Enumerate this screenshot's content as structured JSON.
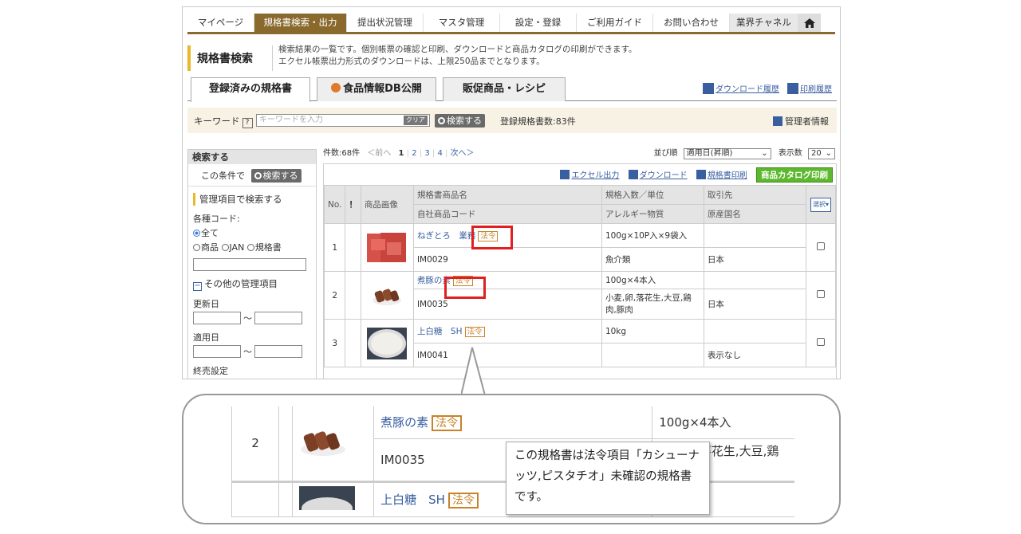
{
  "nav": {
    "items": [
      "マイページ",
      "規格書検索・出力",
      "提出状況管理",
      "マスタ管理",
      "設定・登録",
      "ご利用ガイド",
      "お問い合わせ",
      "業界チャネル"
    ],
    "active_index": 1
  },
  "page": {
    "title": "規格書検索",
    "desc_line1": "検索結果の一覧です。個別帳票の確認と印刷、ダウンロードと商品カタログの印刷ができます。",
    "desc_line2": "エクセル帳票出力形式のダウンロードは、上限250品までとなります。"
  },
  "tabs": [
    "登録済みの規格書",
    "食品情報DB公開",
    "販促商品・レシピ"
  ],
  "history": {
    "download": "ダウンロード履歴",
    "print": "印刷履歴"
  },
  "keyword": {
    "label": "キーワード",
    "help": "?",
    "placeholder": "キーワードを入力",
    "clear": "クリア",
    "search_btn": "検索する",
    "count": "登録規格書数:83件",
    "admin": "管理者情報"
  },
  "sidebar": {
    "header": "検索する",
    "cond_label": "この条件で",
    "search_btn": "検索する",
    "mgmt_title": "管理項目で検索する",
    "code_label": "各種コード:",
    "radio_all": "全て",
    "radio_product": "商品",
    "radio_jan": "JAN",
    "radio_spec": "規格書",
    "other_label": "その他の管理項目",
    "updated_label": "更新日",
    "applied_label": "適用日",
    "tilde": "〜",
    "end_label": "終売設定"
  },
  "results": {
    "count": "件数:68件",
    "prev": "＜前へ",
    "pages": [
      "1",
      "2",
      "3",
      "4"
    ],
    "next": "次へ＞",
    "sort_label": "並び順",
    "sort_value": "適用日(昇順)",
    "per_page_label": "表示数",
    "per_page_value": "20",
    "actions": {
      "excel": "エクセル出力",
      "download": "ダウンロード",
      "print": "規格書印刷",
      "catalog": "商品カタログ印刷"
    },
    "headers": {
      "no": "No.",
      "mark": "！",
      "image": "商品画像",
      "name": "規格書商品名",
      "code": "自社商品コード",
      "qty": "規格入数／単位",
      "allergy": "アレルギー物質",
      "client": "取引先",
      "origin": "原産国名",
      "select": "選択▾"
    },
    "rows": [
      {
        "no": "1",
        "name": "ねぎとろ　業務",
        "badge": "法令",
        "code": "IM0029",
        "qty": "100g×10P入×9袋入",
        "allergy": "魚介類",
        "client": "",
        "origin": "日本"
      },
      {
        "no": "2",
        "name": "煮豚の素",
        "badge": "法令",
        "code": "IM0035",
        "qty": "100g×4本入",
        "allergy": "小麦,卵,落花生,大豆,鶏肉,豚肉",
        "client": "",
        "origin": "日本"
      },
      {
        "no": "3",
        "name": "上白糖　SH",
        "badge": "法令",
        "code": "IM0041",
        "qty": "10kg",
        "allergy": "",
        "client": "",
        "origin": "表示なし"
      }
    ]
  },
  "zoom": {
    "no": "2",
    "name": "煮豚の素",
    "badge": "法令",
    "code": "IM0035",
    "qty": "100g×4本入",
    "allergy_line1": "小麦,卵,落花生,大豆,鶏",
    "allergy_line2": "肉,豚肉",
    "next_name": "上白糖　SH",
    "next_badge": "法令",
    "next_qty": "10kg",
    "tooltip": "この規格書は法令項目「カシューナッツ,ピスタチオ」未確認の規格書です。"
  }
}
